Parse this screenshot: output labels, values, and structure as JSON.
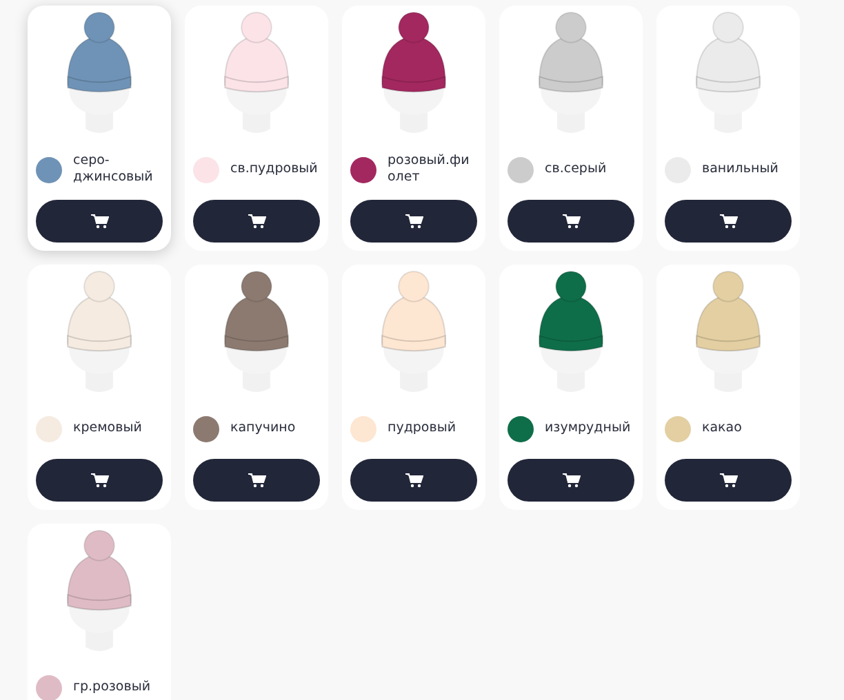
{
  "products": [
    {
      "color_name": "серо-джинсовый",
      "color": "#6f93b6",
      "selected": true
    },
    {
      "color_name": "св.пудровый",
      "color": "#fbe3e8",
      "selected": false
    },
    {
      "color_name": "розовый.фиолет",
      "color": "#a3285f",
      "selected": false
    },
    {
      "color_name": "св.серый",
      "color": "#cccccc",
      "selected": false
    },
    {
      "color_name": "ванильный",
      "color": "#ebebeb",
      "selected": false
    },
    {
      "color_name": "кремовый",
      "color": "#f5ebe1",
      "selected": false
    },
    {
      "color_name": "капучино",
      "color": "#8c7a70",
      "selected": false
    },
    {
      "color_name": "пудровый",
      "color": "#fde6d2",
      "selected": false
    },
    {
      "color_name": "изумрудный",
      "color": "#0f6e4a",
      "selected": false
    },
    {
      "color_name": "какао",
      "color": "#e3cfa2",
      "selected": false
    },
    {
      "color_name": "гр.розовый",
      "color": "#dfbcc5",
      "selected": false
    }
  ]
}
